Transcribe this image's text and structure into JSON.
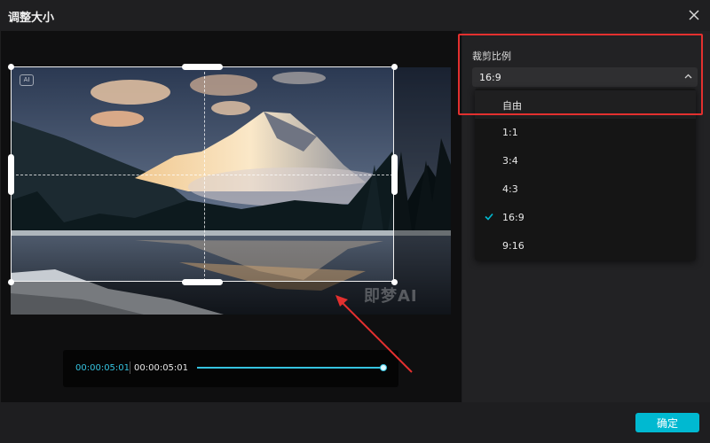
{
  "dialog": {
    "title": "调整大小"
  },
  "preview": {
    "ai_badge": "AI",
    "watermark": "即梦AI",
    "timeline": {
      "current_time": "00:00:05:01",
      "total_time": "00:00:05:01",
      "progress": 1.0
    }
  },
  "settings": {
    "ratio_label": "裁剪比例",
    "selected_ratio": "16:9",
    "options": [
      {
        "label": "自由",
        "selected": false
      },
      {
        "label": "1:1",
        "selected": false
      },
      {
        "label": "3:4",
        "selected": false
      },
      {
        "label": "4:3",
        "selected": false
      },
      {
        "label": "16:9",
        "selected": true
      },
      {
        "label": "9:16",
        "selected": false
      }
    ]
  },
  "footer": {
    "confirm_label": "确定"
  },
  "colors": {
    "accent": "#00b9d1",
    "annotation_red": "#e3302f",
    "dialog_bg": "#1e1e20"
  },
  "icons": {
    "close": "close-icon",
    "chevron": "chevron-up-icon",
    "check": "check-icon"
  }
}
